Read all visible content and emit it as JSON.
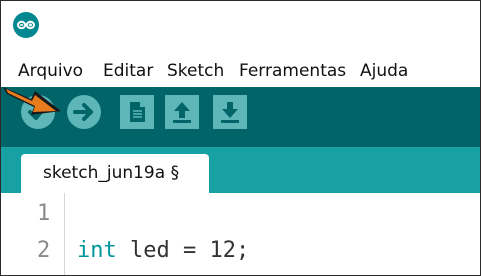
{
  "menu": {
    "items": [
      "Arquivo",
      "Editar",
      "Sketch",
      "Ferramentas",
      "Ajuda"
    ]
  },
  "toolbar": {
    "buttons": [
      {
        "name": "verify",
        "icon": "checkmark-icon"
      },
      {
        "name": "upload",
        "icon": "right-arrow-icon"
      },
      {
        "name": "new",
        "icon": "new-file-icon"
      },
      {
        "name": "open",
        "icon": "up-arrow-icon"
      },
      {
        "name": "save",
        "icon": "down-arrow-icon"
      }
    ]
  },
  "tab": {
    "label": "sketch_jun19a §"
  },
  "editor": {
    "lines": [
      {
        "number": "1",
        "keyword": "",
        "rest": ""
      },
      {
        "number": "2",
        "keyword": "int",
        "rest": " led = 12;"
      }
    ]
  },
  "colors": {
    "toolbar": "#006468",
    "tabstrip": "#17a1a5",
    "button": "#5fb6b9",
    "pointer_arrow": "#e87b1e",
    "keyword": "#00979c"
  }
}
